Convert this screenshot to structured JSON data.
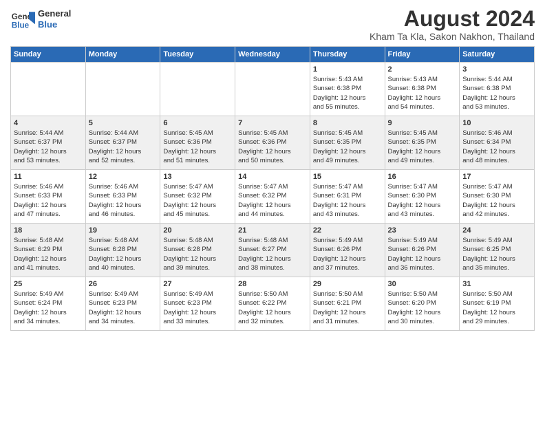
{
  "header": {
    "logo_line1": "General",
    "logo_line2": "Blue",
    "title": "August 2024",
    "subtitle": "Kham Ta Kla, Sakon Nakhon, Thailand"
  },
  "weekdays": [
    "Sunday",
    "Monday",
    "Tuesday",
    "Wednesday",
    "Thursday",
    "Friday",
    "Saturday"
  ],
  "weeks": [
    [
      {
        "day": "",
        "info": ""
      },
      {
        "day": "",
        "info": ""
      },
      {
        "day": "",
        "info": ""
      },
      {
        "day": "",
        "info": ""
      },
      {
        "day": "1",
        "info": "Sunrise: 5:43 AM\nSunset: 6:38 PM\nDaylight: 12 hours\nand 55 minutes."
      },
      {
        "day": "2",
        "info": "Sunrise: 5:43 AM\nSunset: 6:38 PM\nDaylight: 12 hours\nand 54 minutes."
      },
      {
        "day": "3",
        "info": "Sunrise: 5:44 AM\nSunset: 6:38 PM\nDaylight: 12 hours\nand 53 minutes."
      }
    ],
    [
      {
        "day": "4",
        "info": "Sunrise: 5:44 AM\nSunset: 6:37 PM\nDaylight: 12 hours\nand 53 minutes."
      },
      {
        "day": "5",
        "info": "Sunrise: 5:44 AM\nSunset: 6:37 PM\nDaylight: 12 hours\nand 52 minutes."
      },
      {
        "day": "6",
        "info": "Sunrise: 5:45 AM\nSunset: 6:36 PM\nDaylight: 12 hours\nand 51 minutes."
      },
      {
        "day": "7",
        "info": "Sunrise: 5:45 AM\nSunset: 6:36 PM\nDaylight: 12 hours\nand 50 minutes."
      },
      {
        "day": "8",
        "info": "Sunrise: 5:45 AM\nSunset: 6:35 PM\nDaylight: 12 hours\nand 49 minutes."
      },
      {
        "day": "9",
        "info": "Sunrise: 5:45 AM\nSunset: 6:35 PM\nDaylight: 12 hours\nand 49 minutes."
      },
      {
        "day": "10",
        "info": "Sunrise: 5:46 AM\nSunset: 6:34 PM\nDaylight: 12 hours\nand 48 minutes."
      }
    ],
    [
      {
        "day": "11",
        "info": "Sunrise: 5:46 AM\nSunset: 6:33 PM\nDaylight: 12 hours\nand 47 minutes."
      },
      {
        "day": "12",
        "info": "Sunrise: 5:46 AM\nSunset: 6:33 PM\nDaylight: 12 hours\nand 46 minutes."
      },
      {
        "day": "13",
        "info": "Sunrise: 5:47 AM\nSunset: 6:32 PM\nDaylight: 12 hours\nand 45 minutes."
      },
      {
        "day": "14",
        "info": "Sunrise: 5:47 AM\nSunset: 6:32 PM\nDaylight: 12 hours\nand 44 minutes."
      },
      {
        "day": "15",
        "info": "Sunrise: 5:47 AM\nSunset: 6:31 PM\nDaylight: 12 hours\nand 43 minutes."
      },
      {
        "day": "16",
        "info": "Sunrise: 5:47 AM\nSunset: 6:30 PM\nDaylight: 12 hours\nand 43 minutes."
      },
      {
        "day": "17",
        "info": "Sunrise: 5:47 AM\nSunset: 6:30 PM\nDaylight: 12 hours\nand 42 minutes."
      }
    ],
    [
      {
        "day": "18",
        "info": "Sunrise: 5:48 AM\nSunset: 6:29 PM\nDaylight: 12 hours\nand 41 minutes."
      },
      {
        "day": "19",
        "info": "Sunrise: 5:48 AM\nSunset: 6:28 PM\nDaylight: 12 hours\nand 40 minutes."
      },
      {
        "day": "20",
        "info": "Sunrise: 5:48 AM\nSunset: 6:28 PM\nDaylight: 12 hours\nand 39 minutes."
      },
      {
        "day": "21",
        "info": "Sunrise: 5:48 AM\nSunset: 6:27 PM\nDaylight: 12 hours\nand 38 minutes."
      },
      {
        "day": "22",
        "info": "Sunrise: 5:49 AM\nSunset: 6:26 PM\nDaylight: 12 hours\nand 37 minutes."
      },
      {
        "day": "23",
        "info": "Sunrise: 5:49 AM\nSunset: 6:26 PM\nDaylight: 12 hours\nand 36 minutes."
      },
      {
        "day": "24",
        "info": "Sunrise: 5:49 AM\nSunset: 6:25 PM\nDaylight: 12 hours\nand 35 minutes."
      }
    ],
    [
      {
        "day": "25",
        "info": "Sunrise: 5:49 AM\nSunset: 6:24 PM\nDaylight: 12 hours\nand 34 minutes."
      },
      {
        "day": "26",
        "info": "Sunrise: 5:49 AM\nSunset: 6:23 PM\nDaylight: 12 hours\nand 34 minutes."
      },
      {
        "day": "27",
        "info": "Sunrise: 5:49 AM\nSunset: 6:23 PM\nDaylight: 12 hours\nand 33 minutes."
      },
      {
        "day": "28",
        "info": "Sunrise: 5:50 AM\nSunset: 6:22 PM\nDaylight: 12 hours\nand 32 minutes."
      },
      {
        "day": "29",
        "info": "Sunrise: 5:50 AM\nSunset: 6:21 PM\nDaylight: 12 hours\nand 31 minutes."
      },
      {
        "day": "30",
        "info": "Sunrise: 5:50 AM\nSunset: 6:20 PM\nDaylight: 12 hours\nand 30 minutes."
      },
      {
        "day": "31",
        "info": "Sunrise: 5:50 AM\nSunset: 6:19 PM\nDaylight: 12 hours\nand 29 minutes."
      }
    ]
  ]
}
